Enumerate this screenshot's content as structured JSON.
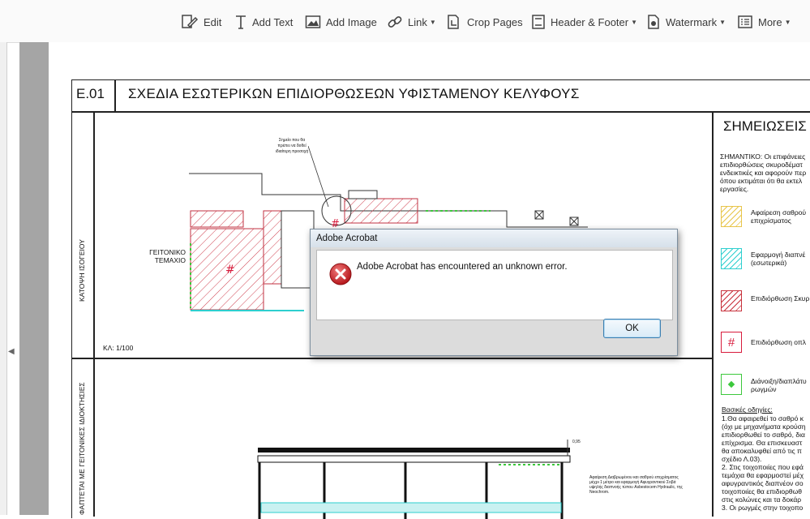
{
  "toolbar": {
    "items": [
      {
        "label": "Edit",
        "icon": "edit-icon",
        "dropdown": false
      },
      {
        "label": "Add Text",
        "icon": "text-icon",
        "dropdown": false
      },
      {
        "label": "Add Image",
        "icon": "image-icon",
        "dropdown": false
      },
      {
        "label": "Link",
        "icon": "link-icon",
        "dropdown": true
      },
      {
        "label": "Crop Pages",
        "icon": "crop-icon",
        "dropdown": false
      },
      {
        "label": "Header & Footer",
        "icon": "header-footer-icon",
        "dropdown": true
      },
      {
        "label": "Watermark",
        "icon": "watermark-icon",
        "dropdown": true
      },
      {
        "label": "More",
        "icon": "more-icon",
        "dropdown": true
      }
    ]
  },
  "document": {
    "code": "Ε.01",
    "title": "ΣΧΕΔΙΑ ΕΣΩΤΕΡΙΚΩΝ ΕΠΙΔΙΟΡΘΩΣΕΩΝ ΥΦΙΣΤΑΜΕΝΟΥ ΚΕΛΥΦΟΥΣ",
    "notes_title": "ΣΗΜΕΙΩΣΕΙΣ",
    "side_label_top": "ΚΑΤΟΨΗ ΙΣΟΓΕΙΟΥ",
    "side_label_bottom": "ΦΑΠΤΕΤΑΙ ΜΕ ΓΕΙΤΟΝΙΚΕΣ ΙΔΙΟΚΤΗΣΙΕΣ",
    "neighbor_label_1": "ΓΕΙΤΟΝΙΚΟ",
    "neighbor_label_2": "ΤΕΜΑΧΙΟ",
    "scale": "ΚΛ: 1/100",
    "callout_1": "Σημείο που θα",
    "callout_2": "πρέπει να δοθεί",
    "callout_3": "ιδιαίτερη προσοχή",
    "section_note_1": "Αφαίρεση Διαβρωμένου και σαθρού επιχρίσματος",
    "section_note_2": "μέχρι 1 μέτρο και εφαρμογή Αφυγραντικού Σοβά",
    "section_note_3": "υψηλής διαπνοής τύπου Asbestocem Hydraulic, της",
    "section_note_4": "Neochrom.",
    "dimension": "0,95",
    "important_1": "ΣΗΜΑΝΤΙΚΟ: Οι επιφάνειες",
    "important_2": "επιδιορθώσεις σκυροδέματ",
    "important_3": "ενδεικτικές και αφορούν περ",
    "important_4": "όπου εκτιμάται ότι θα εκτελ",
    "important_5": "εργασίες.",
    "legend": [
      {
        "line1": "Αφαίρεση σαθρού",
        "line2": "επιχρίσματος",
        "color": "#e8c54a"
      },
      {
        "line1": "Εφαρμογή διαπνέ",
        "line2": "(εσωτερικά)",
        "color": "#2ecfcf"
      },
      {
        "line1": "Επιδιόρθωση Σκυρ",
        "line2": "",
        "color": "#c8323c"
      },
      {
        "line1": "Επιδιόρθωση οπλ",
        "line2": "",
        "color": "#d81b3c"
      },
      {
        "line1": "Διάνοιξη/διαπλάτυ",
        "line2": "ρωγμών",
        "color": "#3cc83c"
      }
    ],
    "basics_title": "Βασικές οδηγίες:",
    "basics_lines": [
      "1.Θα αφαιρεθεί το σαθρό κ",
      "(όχι με μηχανήματα κρούση",
      "επιδιορθωθεί το σαθρό, δια",
      "επίχρισμα. Θα επισκευαστ",
      "θα αποκαλυφθεί από τις π",
      "σχέδιο Λ.03).",
      "2. Στις τοιχοποιίες που εφά",
      "τεμάχια θα εφαρμοστεί μέχ",
      "αφυγραντικός διαπνέον σο",
      "τοιχοποιίες θα επιδιορθωθ",
      "στις κολώνες και τα δοκάρ",
      "3. Οι ρωγμές στην τοιχοπο"
    ]
  },
  "dialog": {
    "title": "Adobe Acrobat",
    "message": "Adobe Acrobat has encountered an unknown error.",
    "ok_label": "OK"
  }
}
